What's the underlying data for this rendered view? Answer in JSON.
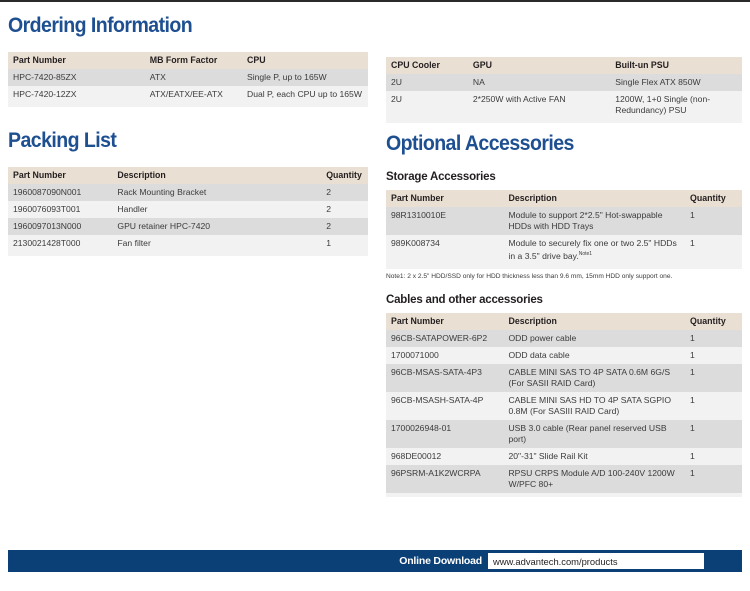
{
  "sections": {
    "ordering": {
      "title": "Ordering Information",
      "table_left": {
        "headers": [
          "Part Number",
          "MB Form Factor",
          "CPU"
        ],
        "rows": [
          [
            "HPC-7420-85ZX",
            "ATX",
            "Single P, up to 165W"
          ],
          [
            "HPC-7420-12ZX",
            "ATX/EATX/EE-ATX",
            "Dual P, each CPU up to 165W"
          ]
        ]
      },
      "table_right": {
        "headers": [
          "CPU Cooler",
          "GPU",
          "Built-un PSU"
        ],
        "rows": [
          [
            "2U",
            "NA",
            "Single Flex ATX 850W"
          ],
          [
            "2U",
            "2*250W with Active FAN",
            "1200W, 1+0 Single (non-Redundancy) PSU"
          ]
        ]
      }
    },
    "packing": {
      "title": "Packing List",
      "table": {
        "headers": [
          "Part Number",
          "Description",
          "Quantity"
        ],
        "rows": [
          [
            "1960087090N001",
            "Rack Mounting Bracket",
            "2"
          ],
          [
            "1960076093T001",
            "Handler",
            "2"
          ],
          [
            "1960097013N000",
            "GPU retainer HPC-7420",
            "2"
          ],
          [
            "2130021428T000",
            "Fan filter",
            "1"
          ]
        ]
      }
    },
    "optional": {
      "title": "Optional Accessories",
      "storage": {
        "subtitle": "Storage Accessories",
        "headers": [
          "Part Number",
          "Description",
          "Quantity"
        ],
        "rows": [
          [
            "98R1310010E",
            "Module to support 2*2.5\" Hot-swappable HDDs with HDD Trays",
            "1"
          ],
          [
            "989K008734",
            "Module to securely fix one or two 2.5\" HDDs in a 3.5\" drive bay.",
            "1"
          ]
        ],
        "note_ref": "Note1",
        "note": "Note1: 2 x 2.5\" HDD/SSD only for HDD thickness less than 9.6 mm, 15mm HDD only support one."
      },
      "cables": {
        "subtitle": "Cables and other accessories",
        "headers": [
          "Part Number",
          "Description",
          "Quantity"
        ],
        "rows": [
          [
            "96CB-SATAPOWER-6P2",
            "ODD power cable",
            "1"
          ],
          [
            "1700071000",
            "ODD data cable",
            "1"
          ],
          [
            "96CB-MSAS-SATA-4P3",
            "CABLE MINI SAS TO 4P SATA 0.6M 6G/S (For SASII RAID Card)",
            "1"
          ],
          [
            "96CB-MSASH-SATA-4P",
            "CABLE MINI SAS HD TO 4P SATA SGPIO 0.8M (For SASIII RAID Card)",
            "1"
          ],
          [
            "1700026948-01",
            "USB 3.0 cable (Rear panel reserved USB port)",
            "1"
          ],
          [
            "968DE00012",
            "20\"-31\" Slide Rail Kit",
            "1"
          ],
          [
            "96PSRM-A1K2WCRPA",
            "RPSU CRPS Module A/D 100-240V 1200W W/PFC 80+",
            "1"
          ]
        ]
      }
    }
  },
  "footer": {
    "label": "Online Download",
    "url": "www.advantech.com/products"
  },
  "colors": {
    "heading_blue": "#1d4f91",
    "table_header_bg": "#eadfd3",
    "row_alt_bg": "#dcdcdc",
    "row_bg": "#f2f2f2",
    "footer_bar": "#0b4077"
  }
}
